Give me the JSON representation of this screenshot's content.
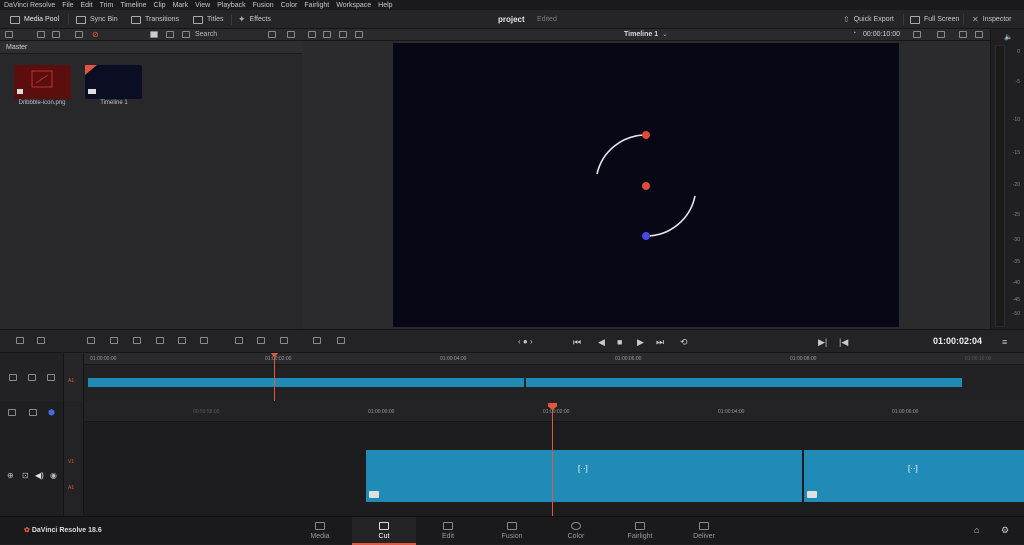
{
  "menubar": {
    "items": [
      "DaVinci Resolve",
      "File",
      "Edit",
      "Trim",
      "Timeline",
      "Clip",
      "Mark",
      "View",
      "Playback",
      "Fusion",
      "Color",
      "Fairlight",
      "Workspace",
      "Help"
    ]
  },
  "toolbar": {
    "media_pool": "Media Pool",
    "sync_bin": "Sync Bin",
    "transitions": "Transitions",
    "titles": "Titles",
    "effects": "Effects",
    "project_name": "project",
    "project_status": "Edited",
    "quick_export": "Quick Export",
    "full_screen": "Full Screen",
    "inspector": "Inspector"
  },
  "subbar": {
    "search_label": "Search",
    "timeline_name": "Timeline 1",
    "duration": "00:00:10:00"
  },
  "mediapool": {
    "bin": "Master",
    "clips": [
      {
        "name": "Dribbble-icon.png"
      },
      {
        "name": "Timeline 1"
      }
    ]
  },
  "meters": {
    "ticks": [
      "0",
      "-5",
      "-10",
      "-15",
      "-20",
      "-25",
      "-30",
      "-35",
      "-40",
      "-45",
      "-50"
    ]
  },
  "transport": {
    "timecode": "01:00:02:04"
  },
  "upper_timeline": {
    "ruler": [
      "01:00:00:00",
      "01:00:02:00",
      "01:00:04:00",
      "01:00:06:00",
      "01:00:08:00",
      "01:00:10:00"
    ],
    "track_label": "A1"
  },
  "lower_timeline": {
    "ruler": [
      "00:59:58:00",
      "01:00:00:00",
      "01:00:02:00",
      "01:00:04:00",
      "01:00:06:00"
    ],
    "v_label": "V1",
    "a_label": "A1"
  },
  "bottombar": {
    "app_name": "DaVinci Resolve 18.6",
    "pages": [
      "Media",
      "Cut",
      "Edit",
      "Fusion",
      "Color",
      "Fairlight",
      "Deliver"
    ],
    "active_page": "Cut"
  },
  "colors": {
    "accent": "#e0563f",
    "clip": "#1f8bb6",
    "viewer_bg": "#070716"
  }
}
